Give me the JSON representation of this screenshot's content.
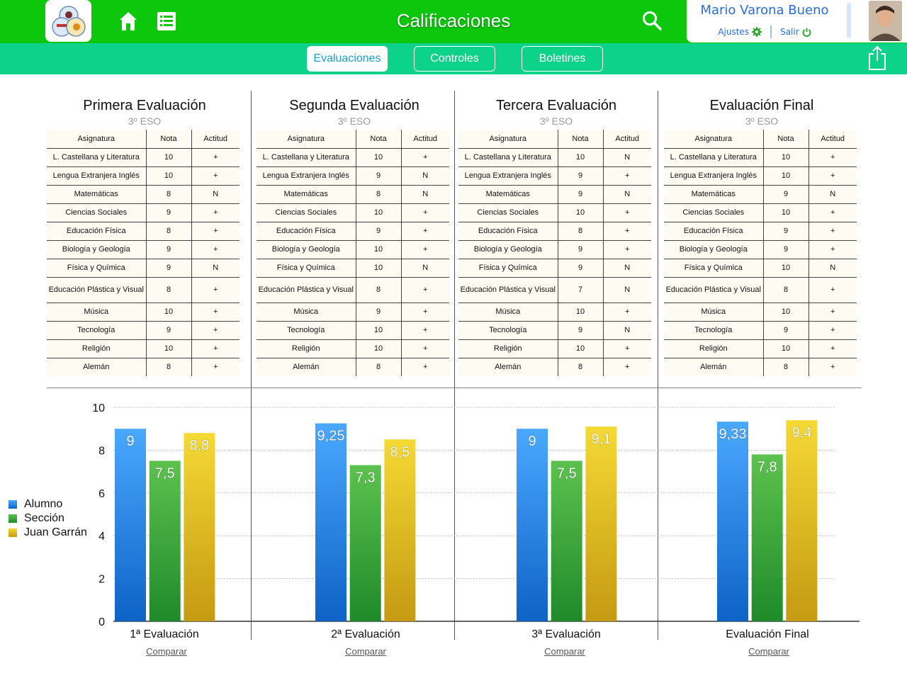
{
  "app": {
    "title": "Calificaciones",
    "user_name": "Mario Varona Bueno",
    "settings_label": "Ajustes",
    "logout_label": "Salir"
  },
  "tabs": [
    {
      "label": "Evaluaciones",
      "active": true
    },
    {
      "label": "Controles",
      "active": false
    },
    {
      "label": "Boletines",
      "active": false
    }
  ],
  "table_headers": {
    "subject": "Asignatura",
    "grade": "Nota",
    "attitude": "Actitud"
  },
  "evaluations": [
    {
      "title": "Primera Evaluación",
      "course": "3º ESO",
      "rows": [
        [
          "L. Castellana y Literatura",
          "10",
          "+"
        ],
        [
          "Lengua Extranjera Inglés",
          "10",
          "+"
        ],
        [
          "Matemáticas",
          "8",
          "N"
        ],
        [
          "Ciencias Sociales",
          "9",
          "+"
        ],
        [
          "Educación Física",
          "8",
          "+"
        ],
        [
          "Biología y Geología",
          "9",
          "+"
        ],
        [
          "Física y Química",
          "9",
          "N"
        ],
        [
          "Educación Plástica y Visual",
          "8",
          "+"
        ],
        [
          "Música",
          "10",
          "+"
        ],
        [
          "Tecnología",
          "9",
          "+"
        ],
        [
          "Religión",
          "10",
          "+"
        ],
        [
          "Alemán",
          "8",
          "+"
        ]
      ]
    },
    {
      "title": "Segunda Evaluación",
      "course": "3º ESO",
      "rows": [
        [
          "L. Castellana y Literatura",
          "10",
          "+"
        ],
        [
          "Lengua Extranjera Inglés",
          "9",
          "N"
        ],
        [
          "Matemáticas",
          "8",
          "N"
        ],
        [
          "Ciencias Sociales",
          "10",
          "+"
        ],
        [
          "Educación Física",
          "9",
          "+"
        ],
        [
          "Biología y Geología",
          "10",
          "+"
        ],
        [
          "Física y Química",
          "10",
          "N"
        ],
        [
          "Educación Plástica y Visual",
          "8",
          "+"
        ],
        [
          "Música",
          "9",
          "+"
        ],
        [
          "Tecnología",
          "10",
          "+"
        ],
        [
          "Religión",
          "10",
          "+"
        ],
        [
          "Alemán",
          "8",
          "+"
        ]
      ]
    },
    {
      "title": "Tercera Evaluación",
      "course": "3º ESO",
      "rows": [
        [
          "L. Castellana y Literatura",
          "10",
          "N"
        ],
        [
          "Lengua Extranjera Inglés",
          "9",
          "+"
        ],
        [
          "Matemáticas",
          "9",
          "N"
        ],
        [
          "Ciencias Sociales",
          "10",
          "+"
        ],
        [
          "Educación Física",
          "8",
          "+"
        ],
        [
          "Biología y Geología",
          "9",
          "+"
        ],
        [
          "Física y Química",
          "9",
          "N"
        ],
        [
          "Educación Plástica y Visual",
          "7",
          "N"
        ],
        [
          "Música",
          "10",
          "+"
        ],
        [
          "Tecnología",
          "9",
          "N"
        ],
        [
          "Religión",
          "10",
          "+"
        ],
        [
          "Alemán",
          "8",
          "+"
        ]
      ]
    },
    {
      "title": "Evaluación Final",
      "course": "3º ESO",
      "rows": [
        [
          "L. Castellana y Literatura",
          "10",
          "+"
        ],
        [
          "Lengua Extranjera Inglés",
          "10",
          "+"
        ],
        [
          "Matemáticas",
          "9",
          "N"
        ],
        [
          "Ciencias Sociales",
          "10",
          "+"
        ],
        [
          "Educación Física",
          "9",
          "+"
        ],
        [
          "Biología y Geología",
          "9",
          "+"
        ],
        [
          "Física y Química",
          "10",
          "N"
        ],
        [
          "Educación Plástica y Visual",
          "8",
          "+"
        ],
        [
          "Música",
          "10",
          "+"
        ],
        [
          "Tecnología",
          "9",
          "+"
        ],
        [
          "Religión",
          "10",
          "+"
        ],
        [
          "Alemán",
          "8",
          "+"
        ]
      ]
    }
  ],
  "compare_label": "Comparar",
  "colors": {
    "top_bar": "#0cc70c",
    "sub_bar": "#0dd38a",
    "alumno": "#2d8ff0",
    "seccion": "#3dad3d",
    "juan": "#e8c21c"
  },
  "chart_data": {
    "type": "bar",
    "categories": [
      "1ª Evaluación",
      "2ª Evaluación",
      "3ª Evaluación",
      "Evaluación Final"
    ],
    "series": [
      {
        "name": "Alumno",
        "values": [
          9,
          9.25,
          9,
          9.33
        ],
        "labels": [
          "9",
          "9,25",
          "9",
          "9,33"
        ]
      },
      {
        "name": "Sección",
        "values": [
          7.5,
          7.3,
          7.5,
          7.8
        ],
        "labels": [
          "7,5",
          "7,3",
          "7,5",
          "7,8"
        ]
      },
      {
        "name": "Juan Garrán",
        "values": [
          8.8,
          8.5,
          9.1,
          9.4
        ],
        "labels": [
          "8,8",
          "8,5",
          "9,1",
          "9,4"
        ]
      }
    ],
    "ylim": [
      0,
      10
    ],
    "yticks": [
      "0",
      "2",
      "4",
      "6",
      "8",
      "10"
    ],
    "grid": true,
    "legend": "left"
  }
}
